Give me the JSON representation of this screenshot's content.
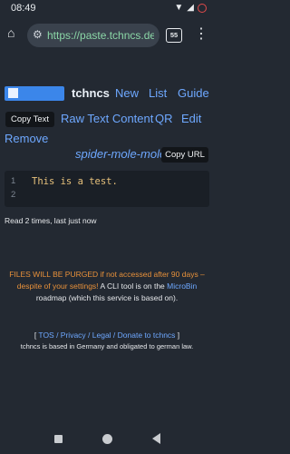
{
  "status": {
    "time": "08:49"
  },
  "browser": {
    "url": "https://paste.tchncs.de/u",
    "tab_count": "55"
  },
  "nav": {
    "brand": "tchncs",
    "new": "New",
    "list": "List",
    "guide": "Guide"
  },
  "actions": {
    "copy_text": "Copy Text",
    "raw_text": "Raw Text Content",
    "qr": "QR",
    "edit": "Edit",
    "remove": "Remove",
    "paste_name": "spider-mole-mole",
    "copy_url": "Copy URL"
  },
  "paste": {
    "line1": "1",
    "line2": "2",
    "content": "This is a test."
  },
  "read_info": "Read 2 times, last just now",
  "footer": {
    "warning_orange": "FILES WILL BE PURGED if not accessed after 90 days – despite of your settings!",
    "warning_rest1": " A CLI tool is on the ",
    "microbin": "MicroBin",
    "warning_rest2": " roadmap (which this service is based on).",
    "links_open": "[ ",
    "links_close": " ]",
    "tos": "TOS / Privacy / Legal / Donate to tchncs",
    "legal": "tchncs is based in Germany and obligated to german law."
  },
  "colors": {
    "background": "#232932",
    "link": "#6ea8ff",
    "orange": "#e8913a",
    "accent_blue": "#3b86ea"
  }
}
